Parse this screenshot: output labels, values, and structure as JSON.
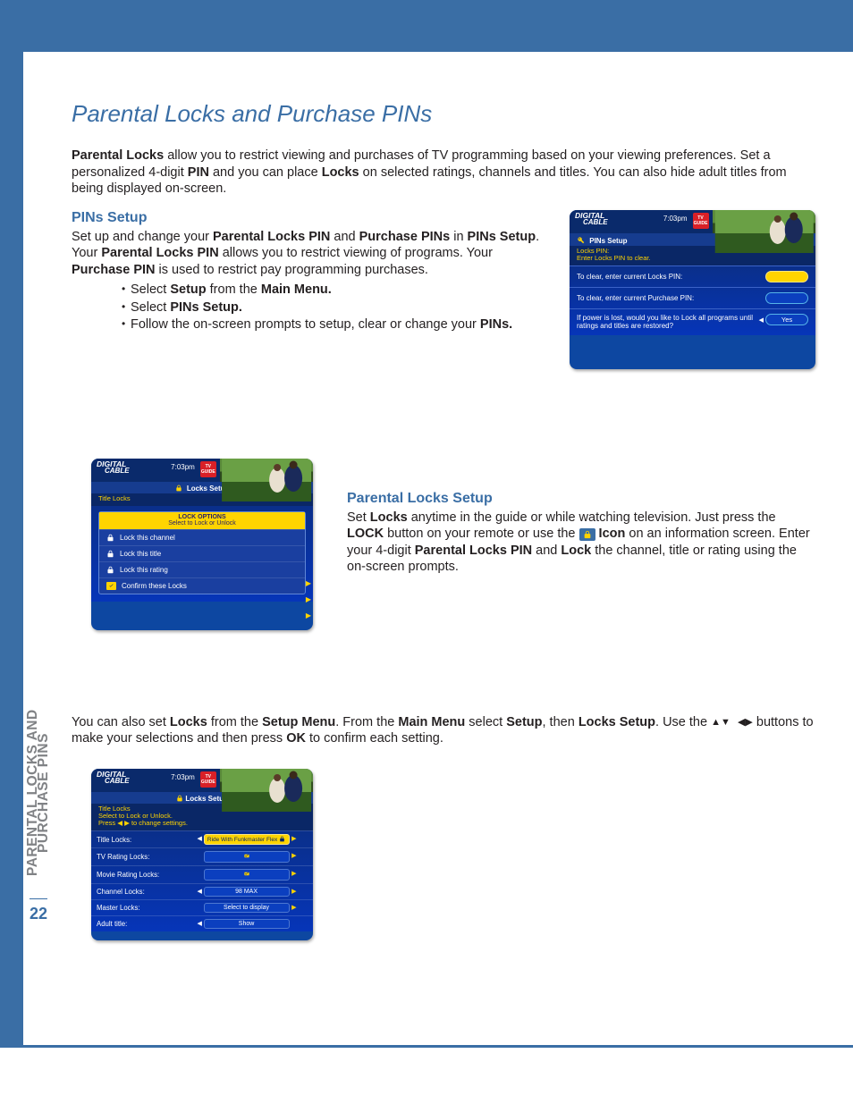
{
  "page": {
    "title": "Parental Locks and Purchase PINs",
    "sidebar_line1": "PARENTAL LOCKS AND",
    "sidebar_line2": "PURCHASE PINS",
    "page_number": "22"
  },
  "intro": {
    "p1a": "Parental Locks",
    "p1b": " allow you to restrict viewing and purchases of TV programming based on your viewing preferences. Set a personalized 4-digit ",
    "p1c": "PIN",
    "p1d": " and you can place ",
    "p1e": "Locks",
    "p1f": " on selected ratings, channels and titles. You can also hide adult titles from being displayed on-screen."
  },
  "pins": {
    "heading": "PINs Setup",
    "t1": "Set up and change your ",
    "t2": "Parental Locks PIN",
    "t3": " and ",
    "t4": "Purchase PINs",
    "t5": " in ",
    "t6": "PINs Setup",
    "t7": ". Your ",
    "t8": "Parental Locks PIN",
    "t9": " allows you to restrict viewing of programs. Your ",
    "t10": "Purchase PIN",
    "t11": " is used to restrict pay programming purchases.",
    "b1a": "Select ",
    "b1b": "Setup",
    "b1c": " from the ",
    "b1d": "Main Menu.",
    "b2a": "Select ",
    "b2b": "PINs Setup.",
    "b3a": "Follow the on-screen prompts to setup, clear or change your ",
    "b3b": "PINs."
  },
  "locks": {
    "heading": "Parental Locks Setup",
    "t1": "Set ",
    "t2": "Locks",
    "t3": " anytime in the guide or while watching television. Just press the ",
    "t4": "LOCK",
    "t5": " button on your remote or use the ",
    "t6": " Icon",
    "t7": " on an information screen. Enter your 4-digit ",
    "t8": "Parental Locks PIN",
    "t9": " and ",
    "t10": "Lock",
    "t11": " the channel, title or rating using the on-screen prompts."
  },
  "also": {
    "t1": "You can also set ",
    "t2": "Locks",
    "t3": " from the ",
    "t4": "Setup Menu",
    "t5": ". From the ",
    "t6": "Main Menu",
    "t7": " select ",
    "t8": "Setup",
    "t9": ", then ",
    "t10": "Locks Setup",
    "t11": ". Use the ",
    "t12": " buttons to make your selections and then press ",
    "t13": "OK",
    "t14": " to confirm each setting."
  },
  "tv": {
    "brand1": "DIGITAL",
    "brand2": "CABLE",
    "time": "7:03pm",
    "tvguide1": "TV",
    "tvguide2": "GUIDE"
  },
  "shotA": {
    "title": "PINs Setup",
    "yel1": "Locks PIN:",
    "yel2": "Enter Locks PIN to clear.",
    "row1": "To clear, enter current Locks PIN:",
    "row2": "To clear, enter current Purchase PIN:",
    "row3": "If power is lost, would you like to Lock all programs until ratings and titles are restored?",
    "yes": "Yes"
  },
  "shotB": {
    "title": "Locks Setup",
    "sub": "Title Locks",
    "opthdr1": "LOCK OPTIONS",
    "opthdr2": "Select to Lock or Unlock",
    "r1": "Lock this channel",
    "r2": "Lock this title",
    "r3": "Lock this rating",
    "r4": "Confirm these Locks"
  },
  "shotC": {
    "title": "Locks Setup",
    "sub1": "Title Locks",
    "sub2": "Select to Lock or Unlock.",
    "sub3": "Press ◀ ▶ to change settings.",
    "rows": {
      "r1l": "Title Locks:",
      "r1v": "Ride With Funkmaster Flex",
      "r2l": "TV Rating Locks:",
      "r3l": "Movie Rating Locks:",
      "r4l": "Channel Locks:",
      "r4v": "98 MAX",
      "r5l": "Master Locks:",
      "r5v": "Select to display",
      "r6l": "Adult title:",
      "r6v": "Show"
    }
  }
}
